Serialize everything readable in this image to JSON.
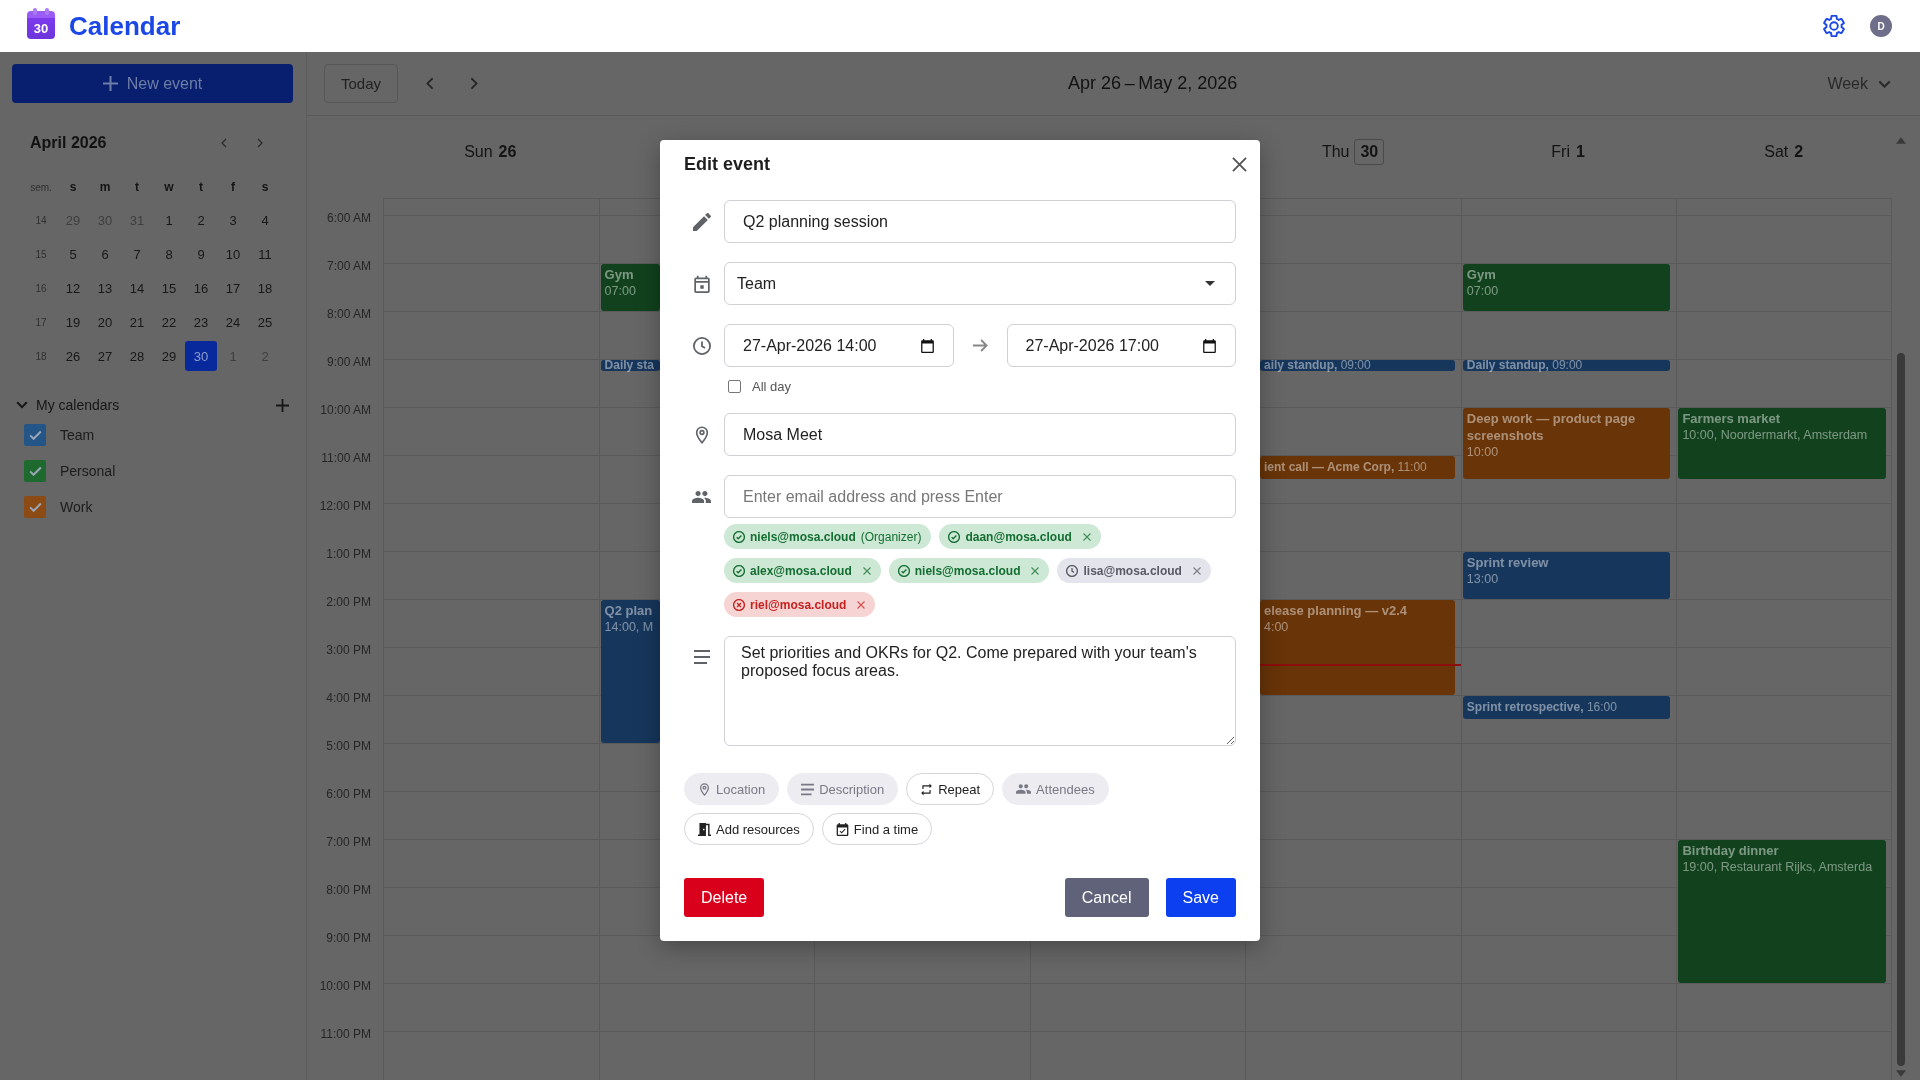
{
  "app": {
    "logo_day": "30",
    "title": "Calendar",
    "avatar_initial": "D"
  },
  "sidebar": {
    "new_event_button": {
      "label": "New event"
    },
    "mini_calendar": {
      "month": "April 2026",
      "week_label": "sem.",
      "weekdays": [
        "s",
        "m",
        "t",
        "w",
        "t",
        "f",
        "s"
      ],
      "weeks": [
        {
          "number": "14",
          "days": [
            {
              "label": "29",
              "outside": true,
              "selected": false
            },
            {
              "label": "30",
              "outside": true,
              "selected": false
            },
            {
              "label": "31",
              "outside": true,
              "selected": false
            },
            {
              "label": "1",
              "outside": false,
              "selected": false
            },
            {
              "label": "2",
              "outside": false,
              "selected": false
            },
            {
              "label": "3",
              "outside": false,
              "selected": false
            },
            {
              "label": "4",
              "outside": false,
              "selected": false
            }
          ]
        },
        {
          "number": "15",
          "days": [
            {
              "label": "5",
              "outside": false,
              "selected": false
            },
            {
              "label": "6",
              "outside": false,
              "selected": false
            },
            {
              "label": "7",
              "outside": false,
              "selected": false
            },
            {
              "label": "8",
              "outside": false,
              "selected": false
            },
            {
              "label": "9",
              "outside": false,
              "selected": false
            },
            {
              "label": "10",
              "outside": false,
              "selected": false
            },
            {
              "label": "11",
              "outside": false,
              "selected": false
            }
          ]
        },
        {
          "number": "16",
          "days": [
            {
              "label": "12",
              "outside": false,
              "selected": false
            },
            {
              "label": "13",
              "outside": false,
              "selected": false
            },
            {
              "label": "14",
              "outside": false,
              "selected": false
            },
            {
              "label": "15",
              "outside": false,
              "selected": false
            },
            {
              "label": "16",
              "outside": false,
              "selected": false
            },
            {
              "label": "17",
              "outside": false,
              "selected": false
            },
            {
              "label": "18",
              "outside": false,
              "selected": false
            }
          ]
        },
        {
          "number": "17",
          "days": [
            {
              "label": "19",
              "outside": false,
              "selected": false
            },
            {
              "label": "20",
              "outside": false,
              "selected": false
            },
            {
              "label": "21",
              "outside": false,
              "selected": false
            },
            {
              "label": "22",
              "outside": false,
              "selected": false
            },
            {
              "label": "23",
              "outside": false,
              "selected": false
            },
            {
              "label": "24",
              "outside": false,
              "selected": false
            },
            {
              "label": "25",
              "outside": false,
              "selected": false
            }
          ]
        },
        {
          "number": "18",
          "days": [
            {
              "label": "26",
              "outside": false,
              "selected": false
            },
            {
              "label": "27",
              "outside": false,
              "selected": false
            },
            {
              "label": "28",
              "outside": false,
              "selected": false
            },
            {
              "label": "29",
              "outside": false,
              "selected": false
            },
            {
              "label": "30",
              "outside": false,
              "selected": true
            },
            {
              "label": "1",
              "outside": true,
              "selected": false
            },
            {
              "label": "2",
              "outside": true,
              "selected": false
            }
          ]
        }
      ]
    },
    "calendars_header": {
      "title": "My calendars",
      "expanded": true
    },
    "calendars": [
      {
        "name": "Team",
        "color": "#235587",
        "checked": true
      },
      {
        "name": "Personal",
        "color": "#1e692d",
        "checked": true
      },
      {
        "name": "Work",
        "color": "#8c4b14",
        "checked": true
      }
    ]
  },
  "toolbar": {
    "today_button": "Today",
    "range": "Apr 26 – May 2, 2026",
    "view": "Week"
  },
  "week": {
    "hours": [
      "6:00 AM",
      "7:00 AM",
      "8:00 AM",
      "9:00 AM",
      "10:00 AM",
      "11:00 AM",
      "12:00 PM",
      "1:00 PM",
      "2:00 PM",
      "3:00 PM",
      "4:00 PM",
      "5:00 PM",
      "6:00 PM",
      "7:00 PM",
      "8:00 PM",
      "9:00 PM",
      "10:00 PM",
      "11:00 PM"
    ],
    "days": [
      {
        "weekday": "Sun",
        "date": "26",
        "today": false
      },
      {
        "events": [
          {
            "kind": "block",
            "title": "Gym",
            "detail": "07:00",
            "color": "#11421d"
          },
          {
            "kind": "compact",
            "title": "Daily sta",
            "color": "#16365c"
          },
          {
            "kind": "block",
            "title": "Q2 plan",
            "detail": "14:00, M",
            "color": "#16365c"
          }
        ]
      },
      {
        "weekday": "Thu",
        "date": "30",
        "today": true,
        "events": [
          {
            "kind": "compact",
            "title": "aily standup,",
            "time": "09:00",
            "color": "#16365c"
          },
          {
            "kind": "compact",
            "title": "ient call — Acme Corp,",
            "time": "11:00",
            "color": "#683408"
          },
          {
            "kind": "block",
            "title": "elease planning — v2.4",
            "detail": "4:00",
            "color": "#683408"
          }
        ]
      },
      {
        "weekday": "Fri",
        "date": "1",
        "today": false,
        "events": [
          {
            "kind": "block",
            "title": "Gym",
            "detail": "07:00",
            "color": "#11421d"
          },
          {
            "kind": "compact",
            "title": "Daily standup,",
            "time": "09:00",
            "color": "#16365c"
          },
          {
            "kind": "block",
            "title": "Deep work — product page screenshots",
            "detail": "10:00",
            "color": "#683408"
          },
          {
            "kind": "block",
            "title": "Sprint review",
            "detail": "13:00",
            "color": "#16365c"
          },
          {
            "kind": "compact",
            "title": "Sprint retrospective,",
            "time": "16:00",
            "color": "#16365c"
          }
        ]
      },
      {
        "weekday": "Sat",
        "date": "2",
        "today": false,
        "events": [
          {
            "kind": "block",
            "title": "Farmers market",
            "detail": "10:00, Noordermarkt, Amsterdam",
            "color": "#11421d"
          },
          {
            "kind": "block",
            "title": "Birthday dinner",
            "detail": "19:00, Restaurant Rijks, Amsterda",
            "color": "#11421d"
          }
        ]
      }
    ]
  },
  "edit_dialog": {
    "title": "Edit event",
    "title_field": {
      "value": "Q2 planning session"
    },
    "calendar_select": {
      "value": "Team"
    },
    "start_field": {
      "value": "27-Apr-2026 14:00"
    },
    "end_field": {
      "value": "27-Apr-2026 17:00"
    },
    "all_day": {
      "label": "All day",
      "checked": false
    },
    "location_field": {
      "value": "Mosa Meet"
    },
    "attendee_field": {
      "placeholder": "Enter email address and press Enter"
    },
    "attendees": [
      {
        "kind": "accepted",
        "email": "niels@mosa.cloud",
        "role": "(Organizer)",
        "removable": false
      },
      {
        "kind": "accepted",
        "email": "daan@mosa.cloud",
        "removable": true
      },
      {
        "kind": "accepted",
        "email": "alex@mosa.cloud",
        "removable": true
      },
      {
        "kind": "accepted",
        "email": "niels@mosa.cloud",
        "removable": true
      },
      {
        "kind": "pending",
        "email": "lisa@mosa.cloud",
        "removable": true
      },
      {
        "kind": "declined",
        "email": "riel@mosa.cloud",
        "removable": true
      }
    ],
    "description_field": {
      "value": "Set priorities and OKRs for Q2. Come prepared with your team's proposed focus areas."
    },
    "options": [
      {
        "kind": "location",
        "label": "Location",
        "disabled": true
      },
      {
        "kind": "description",
        "label": "Description",
        "disabled": true
      },
      {
        "kind": "repeat",
        "label": "Repeat",
        "disabled": false
      },
      {
        "kind": "attendees",
        "label": "Attendees",
        "disabled": true
      },
      {
        "kind": "resources",
        "label": "Add resources",
        "disabled": false
      },
      {
        "kind": "schedule",
        "label": "Find a time",
        "disabled": false
      }
    ],
    "buttons": [
      {
        "kind": "danger",
        "label": "Delete"
      },
      {
        "kind": "secondary",
        "label": "Cancel"
      },
      {
        "kind": "primary",
        "label": "Save"
      }
    ]
  }
}
